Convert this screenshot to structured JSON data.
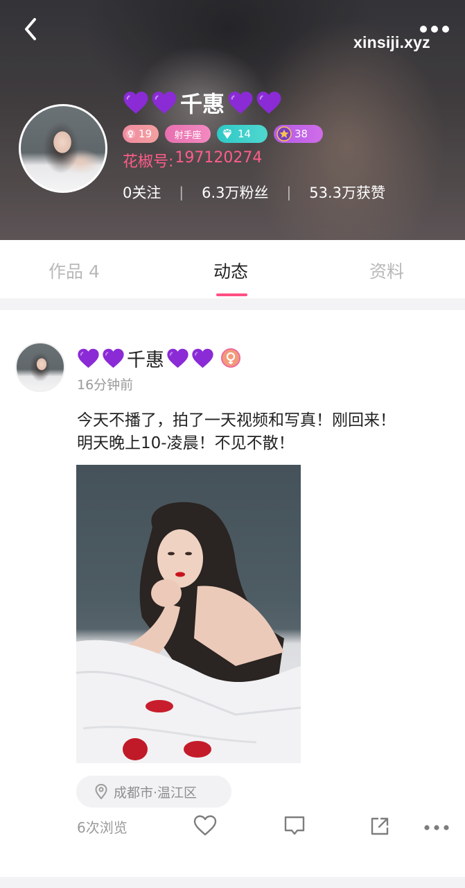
{
  "header": {
    "watermark": "xinsiji.xyz",
    "username": "千惠",
    "heart_count_left": 2,
    "heart_count_right": 2,
    "heart_color": "#8a2bd6",
    "badges": {
      "gender_level": "19",
      "zodiac": "射手座",
      "diamond_level": "14",
      "star_level": "38"
    },
    "id_label": "花椒号:",
    "id_value": "197120274",
    "stats": {
      "following": "0关注",
      "fans": "6.3万粉丝",
      "likes": "53.3万获赞",
      "separator": "|"
    },
    "icons": [
      "back-icon",
      "more-icon"
    ]
  },
  "tabs": [
    {
      "label": "作品 4",
      "active": false
    },
    {
      "label": "动态",
      "active": true
    },
    {
      "label": "资料",
      "active": false
    }
  ],
  "accent_color": "#ff4f83",
  "post": {
    "author": "千惠",
    "time": "16分钟前",
    "text_lines": [
      "今天不播了，拍了一天视频和写真！刚回来！",
      "明天晚上10-凌晨！不见不散！"
    ],
    "location": "成都市·温江区",
    "views": "6次浏览",
    "actions": [
      "heart-icon",
      "comment-icon",
      "share-icon",
      "more-icon"
    ]
  }
}
